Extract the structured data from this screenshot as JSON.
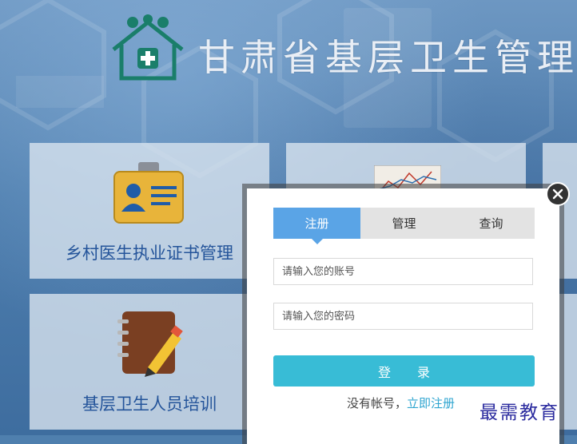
{
  "header": {
    "title": "甘肃省基层卫生管理",
    "logo_icon": "medical-house-logo-icon",
    "logo_color": "#1a7e6a"
  },
  "tiles": [
    {
      "label": "乡村医生执业证书管理",
      "icon": "id-badge-icon"
    },
    {
      "label": "",
      "icon": "chart-document-icon"
    },
    {
      "label": "基层卫生人员培训",
      "icon": "notebook-pencil-icon"
    }
  ],
  "modal": {
    "tabs": [
      "注册",
      "管理",
      "查询"
    ],
    "active_tab": "注册",
    "account_placeholder": "请输入您的账号",
    "password_placeholder": "请输入您的密码",
    "login_label": "登 录",
    "no_account_text": "没有帐号，",
    "register_link": "立即注册",
    "accent_color": "#5aa4e6",
    "button_color": "#38bcd6"
  },
  "watermark": "最需教育"
}
